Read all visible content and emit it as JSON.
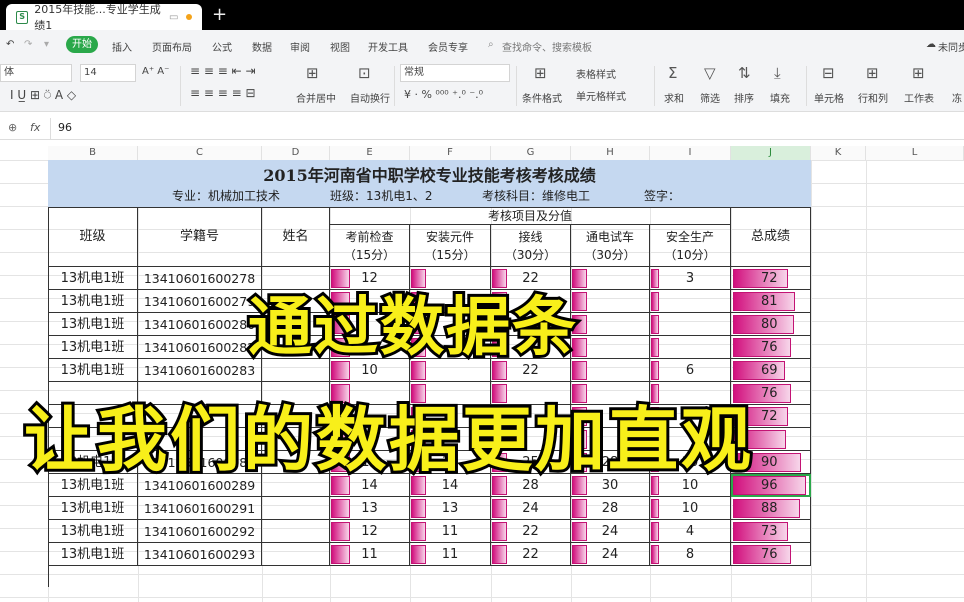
{
  "window": {
    "tab_title": "2015年技能...专业学生成绩1",
    "add_tab": "+"
  },
  "menu": {
    "items": [
      "插入",
      "页面布局",
      "公式",
      "数据",
      "审阅",
      "视图",
      "开发工具",
      "会员专享"
    ],
    "start": "开始",
    "search": "查找命令、搜索模板",
    "cloud": "未同步"
  },
  "ribbon": {
    "font_name": "体",
    "font_size": "14",
    "format": "常规",
    "merge": "合并居中",
    "wrap": "自动换行",
    "cond": "条件格式",
    "table_style": "表格样式",
    "cell_style": "单元格样式",
    "sum": "求和",
    "filter": "筛选",
    "sort": "排序",
    "fill": "填充",
    "cell": "单元格",
    "rowcol": "行和列",
    "sheet": "工作表",
    "freeze": "冻"
  },
  "formula_bar": {
    "fx": "fx",
    "value": "96"
  },
  "columns": [
    "B",
    "C",
    "D",
    "E",
    "F",
    "G",
    "H",
    "I",
    "J",
    "K",
    "L"
  ],
  "title": "2015年河南省中职学校专业技能考核考核成绩",
  "subtitle": {
    "major": "专业：机械加工技术",
    "class": "班级：13机电1、2",
    "subject": "考核科目：维修电工",
    "sign": "签字："
  },
  "headers": {
    "class": "班级",
    "id": "学籍号",
    "name": "姓名",
    "group": "考核项目及分值",
    "total": "总成绩",
    "items": [
      {
        "name": "考前检查",
        "score": "（15分）"
      },
      {
        "name": "安装元件",
        "score": "（15分）"
      },
      {
        "name": "接线",
        "score": "（30分）"
      },
      {
        "name": "通电试车",
        "score": "（30分）"
      },
      {
        "name": "安全生产",
        "score": "（10分）"
      }
    ]
  },
  "rows": [
    {
      "cls": "13机电1班",
      "id": "13410601600278",
      "vals": [
        "12",
        "",
        "22",
        "",
        "3"
      ],
      "total": "72"
    },
    {
      "cls": "13机电1班",
      "id": "13410601600279",
      "vals": [
        "",
        "",
        "",
        "",
        "",
        "",
        ""
      ],
      "total": "81"
    },
    {
      "cls": "13机电1班",
      "id": "13410601600280",
      "vals": [
        "",
        "",
        "",
        "",
        ""
      ],
      "total": "80"
    },
    {
      "cls": "13机电1班",
      "id": "13410601600282",
      "vals": [
        "",
        "",
        "",
        "",
        ""
      ],
      "total": "76"
    },
    {
      "cls": "13机电1班",
      "id": "13410601600283",
      "vals": [
        "10",
        "",
        "22",
        "",
        "6"
      ],
      "total": "69"
    },
    {
      "cls": "",
      "id": "",
      "vals": [
        "",
        "",
        "",
        "",
        ""
      ],
      "total": "76"
    },
    {
      "cls": "",
      "id": "",
      "vals": [
        "",
        "",
        "",
        "",
        ""
      ],
      "total": "72"
    },
    {
      "cls": "",
      "id": "",
      "vals": [
        "",
        "",
        "",
        "",
        ""
      ],
      "total": ""
    },
    {
      "cls": "13机电1班",
      "id": "13410601600288",
      "vals": [
        "13",
        "14",
        "25",
        "28",
        "10"
      ],
      "total": "90"
    },
    {
      "cls": "13机电1班",
      "id": "13410601600289",
      "vals": [
        "14",
        "14",
        "28",
        "30",
        "10"
      ],
      "total": "96"
    },
    {
      "cls": "13机电1班",
      "id": "13410601600291",
      "vals": [
        "13",
        "13",
        "24",
        "28",
        "10"
      ],
      "total": "88"
    },
    {
      "cls": "13机电1班",
      "id": "13410601600292",
      "vals": [
        "12",
        "11",
        "22",
        "24",
        "4"
      ],
      "total": "73"
    },
    {
      "cls": "13机电1班",
      "id": "13410601600293",
      "vals": [
        "11",
        "11",
        "22",
        "24",
        "8"
      ],
      "total": "76"
    }
  ],
  "bars": {
    "item_fill": [
      0.25,
      0.2,
      0.2,
      0.2,
      0.1
    ],
    "total_fill": [
      0.72,
      0.81,
      0.8,
      0.76,
      0.69,
      0.76,
      0.72,
      0.7,
      0.9,
      0.96,
      0.88,
      0.73,
      0.76
    ]
  },
  "caption": {
    "line1": "通过数据条",
    "line2": "让我们的数据更加直观"
  },
  "colors": {
    "accent": "#2aa84a",
    "bar": "#d2107e",
    "caption": "#f8ef1a",
    "title_bg": "#c5d8f0"
  }
}
